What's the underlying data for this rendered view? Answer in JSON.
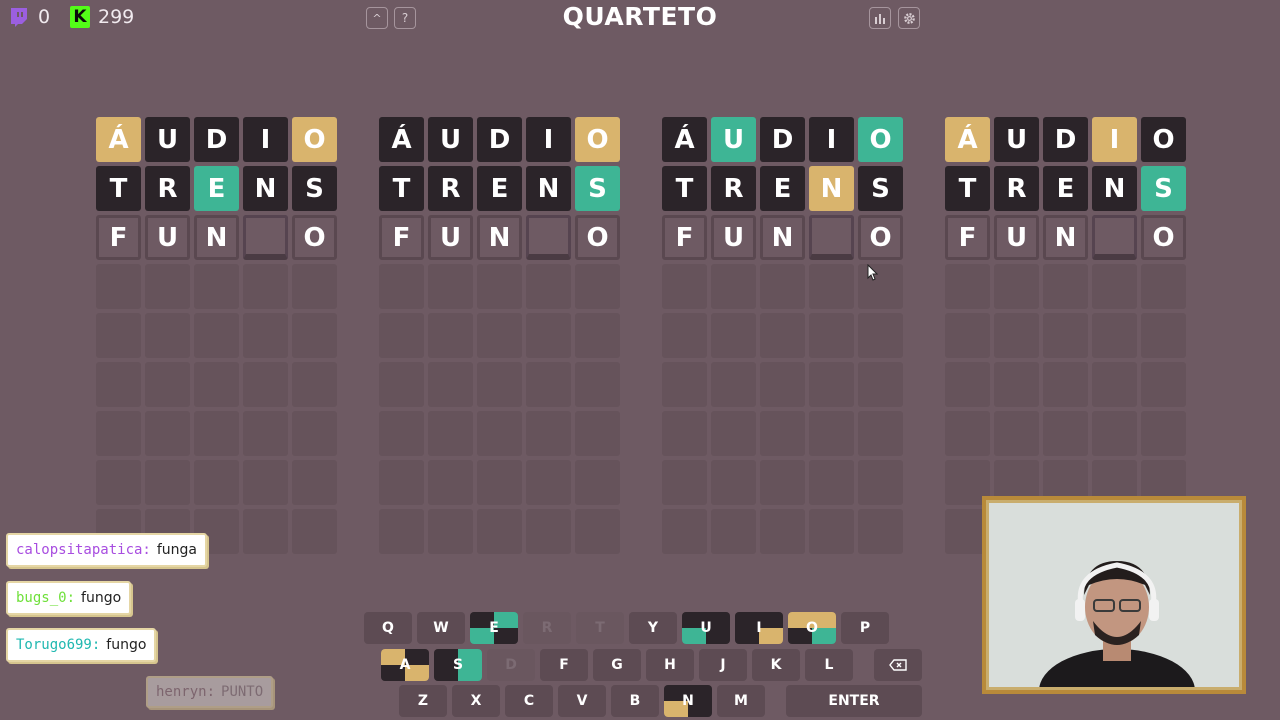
{
  "header": {
    "title": "QUARTETO",
    "twitch_count": "0",
    "kick_count": "299",
    "kick_logo": "K"
  },
  "boards": [
    {
      "rows": [
        [
          "Á",
          "U",
          "D",
          "I",
          "O"
        ],
        [
          "T",
          "R",
          "E",
          "N",
          "S"
        ],
        [
          "F",
          "U",
          "N",
          "",
          "O"
        ]
      ],
      "colors": [
        [
          "yl",
          "dk",
          "dk",
          "dk",
          "yl"
        ],
        [
          "dk",
          "dk",
          "gr",
          "dk",
          "dk"
        ],
        [
          "cur",
          "cur",
          "cur",
          "cur empty",
          "cur"
        ]
      ]
    },
    {
      "rows": [
        [
          "Á",
          "U",
          "D",
          "I",
          "O"
        ],
        [
          "T",
          "R",
          "E",
          "N",
          "S"
        ],
        [
          "F",
          "U",
          "N",
          "",
          "O"
        ]
      ],
      "colors": [
        [
          "dk",
          "dk",
          "dk",
          "dk",
          "yl"
        ],
        [
          "dk",
          "dk",
          "dk",
          "dk",
          "gr"
        ],
        [
          "cur",
          "cur",
          "cur",
          "cur empty",
          "cur"
        ]
      ]
    },
    {
      "rows": [
        [
          "Á",
          "U",
          "D",
          "I",
          "O"
        ],
        [
          "T",
          "R",
          "E",
          "N",
          "S"
        ],
        [
          "F",
          "U",
          "N",
          "",
          "O"
        ]
      ],
      "colors": [
        [
          "dk",
          "gr",
          "dk",
          "dk",
          "gr"
        ],
        [
          "dk",
          "dk",
          "dk",
          "yl",
          "dk"
        ],
        [
          "cur",
          "cur",
          "cur",
          "cur empty",
          "cur"
        ]
      ]
    },
    {
      "rows": [
        [
          "Á",
          "U",
          "D",
          "I",
          "O"
        ],
        [
          "T",
          "R",
          "E",
          "N",
          "S"
        ],
        [
          "F",
          "U",
          "N",
          "",
          "O"
        ]
      ],
      "colors": [
        [
          "yl",
          "dk",
          "dk",
          "yl",
          "dk"
        ],
        [
          "dk",
          "dk",
          "dk",
          "dk",
          "gr"
        ],
        [
          "cur",
          "cur",
          "cur",
          "cur empty",
          "cur"
        ]
      ]
    }
  ],
  "keyboard": {
    "row1": [
      "Q",
      "W",
      "E",
      "R",
      "T",
      "Y",
      "U",
      "I",
      "O",
      "P"
    ],
    "row2": [
      "A",
      "S",
      "D",
      "F",
      "G",
      "H",
      "J",
      "K",
      "L"
    ],
    "row3": [
      "Z",
      "X",
      "C",
      "V",
      "B",
      "N",
      "M"
    ],
    "enter_label": "ENTER",
    "backspace_icon": "backspace-icon"
  },
  "chat": [
    {
      "user": "calopsitapatica:",
      "message": "funga",
      "color": "#a84de0"
    },
    {
      "user": "bugs_0:",
      "message": "fungo",
      "color": "#6fe03a"
    },
    {
      "user": "Torugo699:",
      "message": "fungo",
      "color": "#1fb8b0"
    },
    {
      "user": "henryn:",
      "message": "PUNTO",
      "color": "#8a6f78"
    }
  ],
  "colors": {
    "background": "#6e5a63",
    "correct": "#3eb595",
    "present": "#d9b46d",
    "absent": "#2b2429"
  }
}
